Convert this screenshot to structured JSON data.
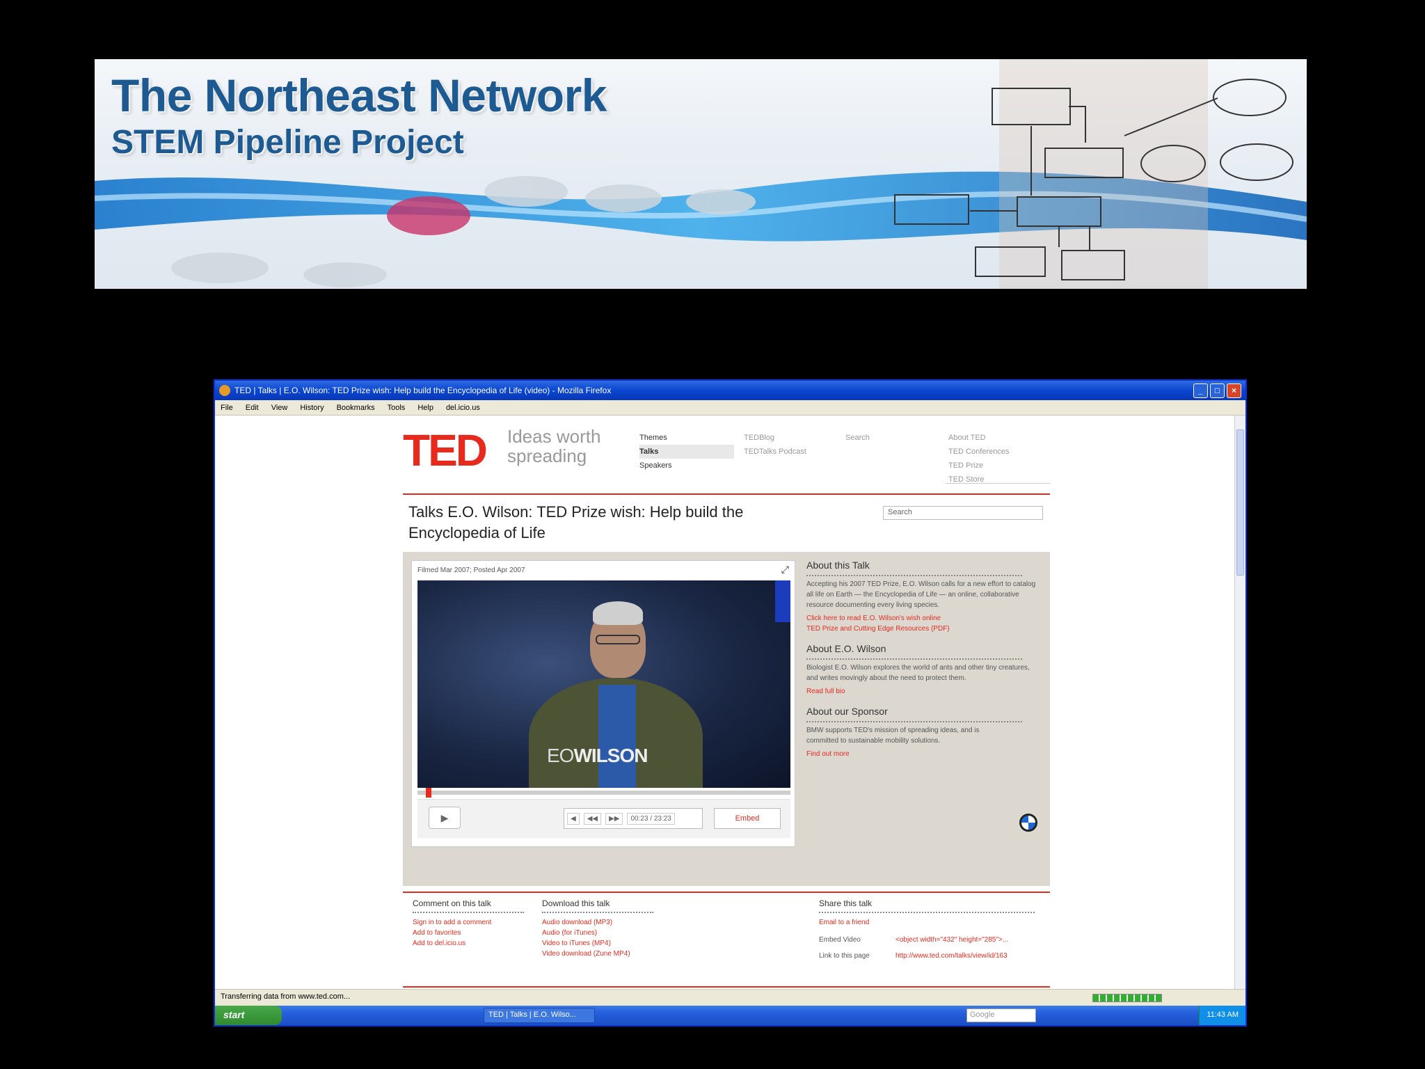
{
  "banner": {
    "title": "The Northeast Network",
    "subtitle": "STEM Pipeline Project"
  },
  "window": {
    "title": "TED | Talks | E.O. Wilson: TED Prize wish: Help build the Encyclopedia of Life (video) - Mozilla Firefox",
    "menu": [
      "File",
      "Edit",
      "View",
      "History",
      "Bookmarks",
      "Tools",
      "Help",
      "del.icio.us"
    ]
  },
  "ted": {
    "logo": "TED",
    "tagline": "Ideas worth spreading",
    "nav_primary": [
      "Themes",
      "Talks",
      "Speakers"
    ],
    "nav_secondary": [
      "TEDBlog",
      "TEDTalks Podcast"
    ],
    "nav_third": [
      "Search"
    ],
    "nav_about": [
      "About TED",
      "TED Conferences",
      "TED Prize",
      "TED Store"
    ],
    "talk_title": "Talks E.O. Wilson: TED Prize wish: Help build the Encyclopedia of Life",
    "search_placeholder": "Search"
  },
  "player": {
    "meta": "Filmed Mar 2007; Posted Apr 2007",
    "caption_prefix": "EO",
    "caption_name": "WILSON",
    "time": "00:23 / 23:23",
    "embed_label": "Embed"
  },
  "about_talk": {
    "heading": "About this Talk",
    "body": "Accepting his 2007 TED Prize, E.O. Wilson calls for a new effort to catalog all life on Earth — the Encyclopedia of Life — an online, collaborative resource documenting every living species.",
    "link1": "Click here to read E.O. Wilson's wish online",
    "link2": "TED Prize and Cutting Edge Resources (PDF)"
  },
  "about_speaker": {
    "heading": "About E.O. Wilson",
    "body": "Biologist E.O. Wilson explores the world of ants and other tiny creatures, and writes movingly about the need to protect them.",
    "link": "Read full bio"
  },
  "about_sponsor": {
    "heading": "About our Sponsor",
    "body": "BMW supports TED's mission of spreading ideas, and is committed to sustainable mobility solutions.",
    "link": "Find out more"
  },
  "footer": {
    "comment_heading": "Comment on this talk",
    "comment_links": [
      "Sign in to add a comment",
      "Add to favorites",
      "Add to del.icio.us"
    ],
    "download_heading": "Download this talk",
    "download_links": [
      "Audio download (MP3)",
      "Audio (for iTunes)",
      "Video to iTunes (MP4)",
      "Video download (Zune MP4)"
    ],
    "share_heading": "Share this talk",
    "share_link": "Email to a friend",
    "embed_label": "Embed Video",
    "embed_value": "<object width=\"432\" height=\"285\">...",
    "link_label": "Link to this page",
    "link_value": "http://www.ted.com/talks/view/id/163"
  },
  "status": {
    "text": "Transferring data from www.ted.com..."
  },
  "taskbar": {
    "start": "start",
    "task": "TED | Talks | E.O. Wilso...",
    "search": "Google",
    "clock": "11:43 AM"
  }
}
